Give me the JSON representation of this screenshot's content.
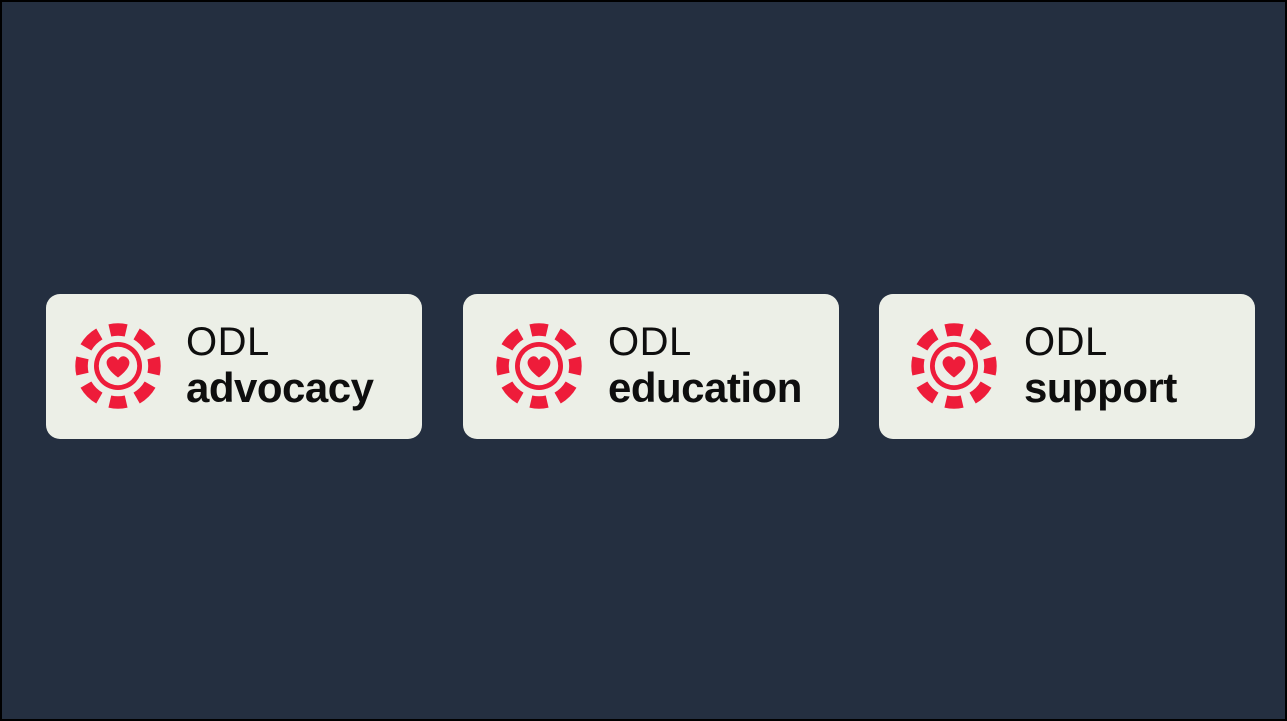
{
  "background_color": "#242f40",
  "card_color": "#ecefe7",
  "accent_color": "#ee1c3a",
  "badges": [
    {
      "brand": "ODL",
      "word": "advocacy",
      "icon": "heart-target-icon"
    },
    {
      "brand": "ODL",
      "word": "education",
      "icon": "heart-target-icon"
    },
    {
      "brand": "ODL",
      "word": "support",
      "icon": "heart-target-icon"
    }
  ]
}
